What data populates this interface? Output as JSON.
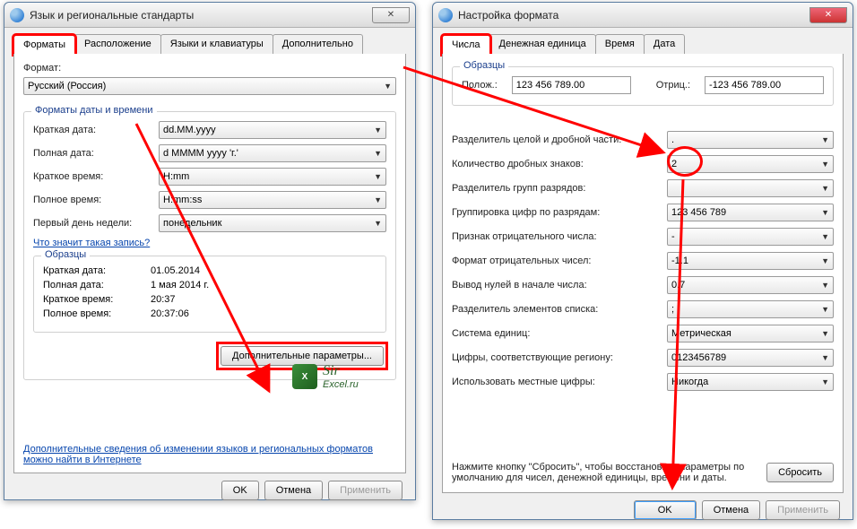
{
  "window1": {
    "title": "Язык и региональные стандарты",
    "tabs": [
      "Форматы",
      "Расположение",
      "Языки и клавиатуры",
      "Дополнительно"
    ],
    "format_label": "Формат:",
    "format_value": "Русский (Россия)",
    "datetime_group": "Форматы даты и времени",
    "fields": [
      {
        "label": "Краткая дата:",
        "value": "dd.MM.yyyy"
      },
      {
        "label": "Полная дата:",
        "value": "d MMMM yyyy 'г.'"
      },
      {
        "label": "Краткое время:",
        "value": "H:mm"
      },
      {
        "label": "Полное время:",
        "value": "H:mm:ss"
      },
      {
        "label": "Первый день недели:",
        "value": "понедельник"
      }
    ],
    "notation_link": "Что значит такая запись?",
    "samples_group": "Образцы",
    "samples": [
      {
        "label": "Краткая дата:",
        "value": "01.05.2014"
      },
      {
        "label": "Полная дата:",
        "value": "1 мая 2014 г."
      },
      {
        "label": "Краткое время:",
        "value": "20:37"
      },
      {
        "label": "Полное время:",
        "value": "20:37:06"
      }
    ],
    "extra_button": "Дополнительные параметры...",
    "info_link": "Дополнительные сведения об изменении языков и региональных форматов можно найти в Интернете",
    "ok": "OK",
    "cancel": "Отмена",
    "apply": "Применить"
  },
  "window2": {
    "title": "Настройка формата",
    "tabs": [
      "Числа",
      "Денежная единица",
      "Время",
      "Дата"
    ],
    "samples_group": "Образцы",
    "pos_label": "Полож.:",
    "pos_value": "123 456 789.00",
    "neg_label": "Отриц.:",
    "neg_value": "-123 456 789.00",
    "fields": [
      {
        "label": "Разделитель целой и дробной части:",
        "value": "."
      },
      {
        "label": "Количество дробных знаков:",
        "value": "2"
      },
      {
        "label": "Разделитель групп разрядов:",
        "value": ""
      },
      {
        "label": "Группировка цифр по разрядам:",
        "value": "123 456 789"
      },
      {
        "label": "Признак отрицательного числа:",
        "value": "-"
      },
      {
        "label": "Формат отрицательных чисел:",
        "value": "-1.1"
      },
      {
        "label": "Вывод нулей в начале числа:",
        "value": "0.7"
      },
      {
        "label": "Разделитель элементов списка:",
        "value": ";"
      },
      {
        "label": "Система единиц:",
        "value": "Метрическая"
      },
      {
        "label": "Цифры, соответствующие региону:",
        "value": "0123456789"
      },
      {
        "label": "Использовать местные цифры:",
        "value": "Никогда"
      }
    ],
    "reset_hint": "Нажмите кнопку \"Сбросить\", чтобы восстановить параметры по умолчанию для чисел, денежной единицы, времени и даты.",
    "reset": "Сбросить",
    "ok": "OK",
    "cancel": "Отмена",
    "apply": "Применить"
  },
  "logo": {
    "name": "Sir",
    "sub": "Excel.ru"
  }
}
